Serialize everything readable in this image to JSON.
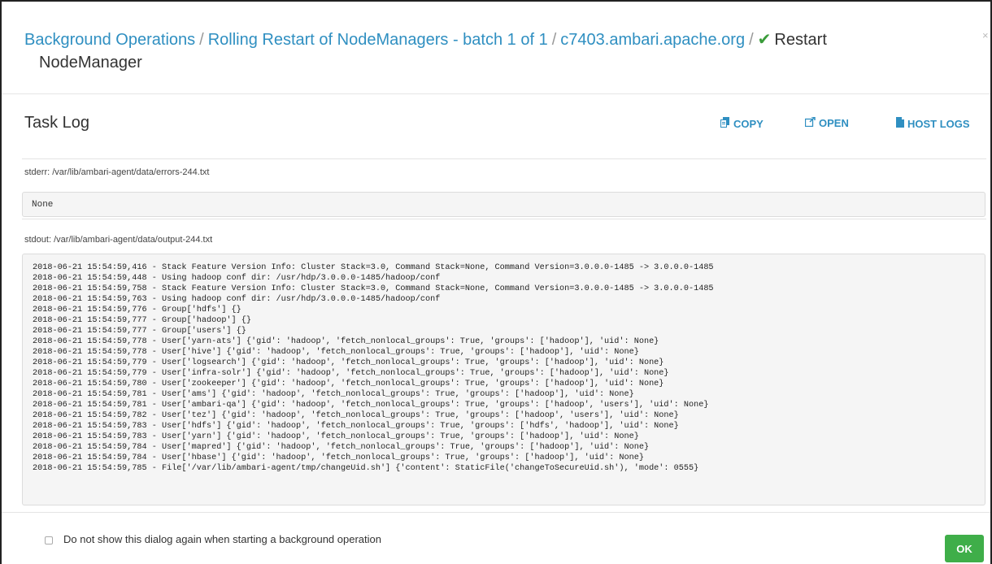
{
  "dialog": {
    "breadcrumb": [
      {
        "label": "Background Operations"
      },
      {
        "label": "Rolling Restart of NodeManagers - batch 1 of 1"
      },
      {
        "label": "c7403.ambari.apache.org"
      }
    ],
    "separator": "/",
    "current": "Restart NodeManager",
    "current_part1": "Restart",
    "current_part2": "NodeManager",
    "close_glyph": "×"
  },
  "task_log": {
    "title": "Task Log",
    "actions": {
      "copy": "COPY",
      "open": "OPEN",
      "host_logs": "HOST LOGS"
    }
  },
  "stderr": {
    "label": "stderr:  /var/lib/ambari-agent/data/errors-244.txt",
    "content": "None"
  },
  "stdout": {
    "label": "stdout:  /var/lib/ambari-agent/data/output-244.txt",
    "lines": [
      "2018-06-21 15:54:59,416 - Stack Feature Version Info: Cluster Stack=3.0, Command Stack=None, Command Version=3.0.0.0-1485 -> 3.0.0.0-1485",
      "2018-06-21 15:54:59,448 - Using hadoop conf dir: /usr/hdp/3.0.0.0-1485/hadoop/conf",
      "2018-06-21 15:54:59,758 - Stack Feature Version Info: Cluster Stack=3.0, Command Stack=None, Command Version=3.0.0.0-1485 -> 3.0.0.0-1485",
      "2018-06-21 15:54:59,763 - Using hadoop conf dir: /usr/hdp/3.0.0.0-1485/hadoop/conf",
      "2018-06-21 15:54:59,776 - Group['hdfs'] {}",
      "2018-06-21 15:54:59,777 - Group['hadoop'] {}",
      "2018-06-21 15:54:59,777 - Group['users'] {}",
      "2018-06-21 15:54:59,778 - User['yarn-ats'] {'gid': 'hadoop', 'fetch_nonlocal_groups': True, 'groups': ['hadoop'], 'uid': None}",
      "2018-06-21 15:54:59,778 - User['hive'] {'gid': 'hadoop', 'fetch_nonlocal_groups': True, 'groups': ['hadoop'], 'uid': None}",
      "2018-06-21 15:54:59,779 - User['logsearch'] {'gid': 'hadoop', 'fetch_nonlocal_groups': True, 'groups': ['hadoop'], 'uid': None}",
      "2018-06-21 15:54:59,779 - User['infra-solr'] {'gid': 'hadoop', 'fetch_nonlocal_groups': True, 'groups': ['hadoop'], 'uid': None}",
      "2018-06-21 15:54:59,780 - User['zookeeper'] {'gid': 'hadoop', 'fetch_nonlocal_groups': True, 'groups': ['hadoop'], 'uid': None}",
      "2018-06-21 15:54:59,781 - User['ams'] {'gid': 'hadoop', 'fetch_nonlocal_groups': True, 'groups': ['hadoop'], 'uid': None}",
      "2018-06-21 15:54:59,781 - User['ambari-qa'] {'gid': 'hadoop', 'fetch_nonlocal_groups': True, 'groups': ['hadoop', 'users'], 'uid': None}",
      "2018-06-21 15:54:59,782 - User['tez'] {'gid': 'hadoop', 'fetch_nonlocal_groups': True, 'groups': ['hadoop', 'users'], 'uid': None}",
      "2018-06-21 15:54:59,783 - User['hdfs'] {'gid': 'hadoop', 'fetch_nonlocal_groups': True, 'groups': ['hdfs', 'hadoop'], 'uid': None}",
      "2018-06-21 15:54:59,783 - User['yarn'] {'gid': 'hadoop', 'fetch_nonlocal_groups': True, 'groups': ['hadoop'], 'uid': None}",
      "2018-06-21 15:54:59,784 - User['mapred'] {'gid': 'hadoop', 'fetch_nonlocal_groups': True, 'groups': ['hadoop'], 'uid': None}",
      "2018-06-21 15:54:59,784 - User['hbase'] {'gid': 'hadoop', 'fetch_nonlocal_groups': True, 'groups': ['hadoop'], 'uid': None}",
      "2018-06-21 15:54:59,785 - File['/var/lib/ambari-agent/tmp/changeUid.sh'] {'content': StaticFile('changeToSecureUid.sh'), 'mode': 0555}"
    ]
  },
  "footer": {
    "checkbox_label": "Do not show this dialog again when starting a background operation",
    "checkbox_checked": false,
    "ok_label": "OK"
  },
  "colors": {
    "link": "#2f8fc1",
    "success_check": "#3a9c3a",
    "ok_button": "#3fae49",
    "log_background": "#f5f5f5"
  },
  "icons": {
    "copy": "copy-icon",
    "open": "external-link-icon",
    "host_logs": "file-icon",
    "status": "checkmark-icon"
  }
}
